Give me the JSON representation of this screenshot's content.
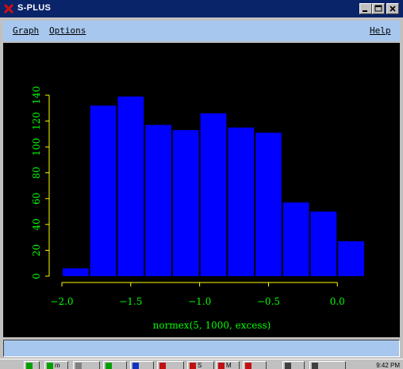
{
  "window": {
    "title": "S-PLUS",
    "accent": "#0a246a",
    "menu_bg": "#a7c7ee",
    "close_icon": "close-icon",
    "minimize_icon": "minimize-icon",
    "maximize_icon": "maximize-icon"
  },
  "menu": {
    "graph_label": "Graph",
    "options_label": "Options",
    "help_label": "Help"
  },
  "taskbar": {
    "items": [
      "",
      "m",
      "",
      "",
      "",
      "",
      "S",
      "M",
      "",
      "",
      ""
    ],
    "clock": "9:42 PM"
  },
  "chart_data": {
    "type": "bar",
    "title": "",
    "xlabel": "normex(5, 1000, excess)",
    "ylabel": "",
    "bar_color": "#0000ff",
    "axis_color": "#ffff00",
    "label_color": "#00ff00",
    "background": "#000000",
    "bin_edges": [
      -2.0,
      -1.8,
      -1.6,
      -1.4,
      -1.2,
      -1.0,
      -0.8,
      -0.6,
      -0.4,
      -0.2,
      0.0,
      0.2
    ],
    "values": [
      6,
      132,
      139,
      117,
      113,
      126,
      115,
      111,
      57,
      50,
      27
    ],
    "xticks": [
      -2.0,
      -1.5,
      -1.0,
      -0.5,
      0.0
    ],
    "xtick_labels": [
      "−2.0",
      "−1.5",
      "−1.0",
      "−0.5",
      "0.0"
    ],
    "yticks": [
      0,
      20,
      40,
      60,
      80,
      100,
      120,
      140
    ],
    "ytick_labels": [
      "0",
      "20",
      "40",
      "60",
      "80",
      "100",
      "120",
      "140"
    ],
    "xlim": [
      -2.0,
      0.2
    ],
    "ylim": [
      0,
      140
    ],
    "grid": false
  }
}
